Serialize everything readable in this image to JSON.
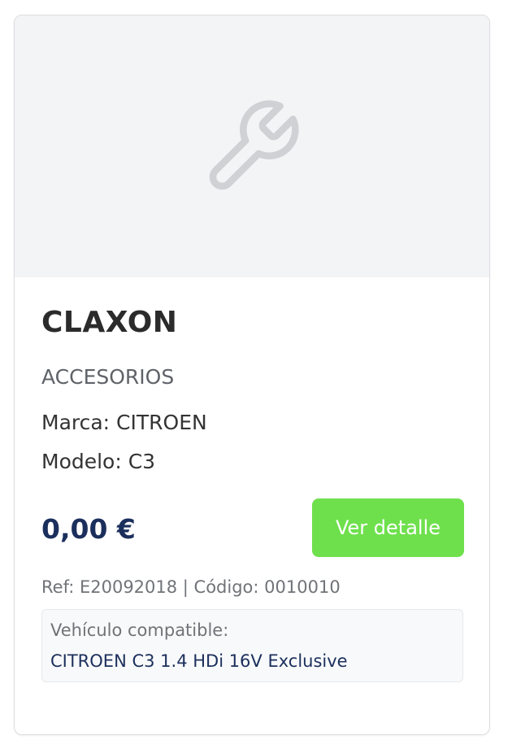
{
  "product": {
    "image_icon": "wrench-icon",
    "name": "CLAXON",
    "category": "ACCESORIOS",
    "brand": "Marca: CITROEN",
    "model": "Modelo: C3",
    "price": "0,00 €",
    "detail_button_label": "Ver detalle",
    "ref_line": "Ref: E20092018 | Código: 0010010",
    "compat_label": "Vehículo compatible:",
    "compat_value": "CITROEN C3 1.4 HDi 16V Exclusive"
  },
  "colors": {
    "button": "#6ee04c",
    "price": "#1b2f5c",
    "image_background": "#f3f4f6",
    "icon": "#cfd1d5"
  }
}
